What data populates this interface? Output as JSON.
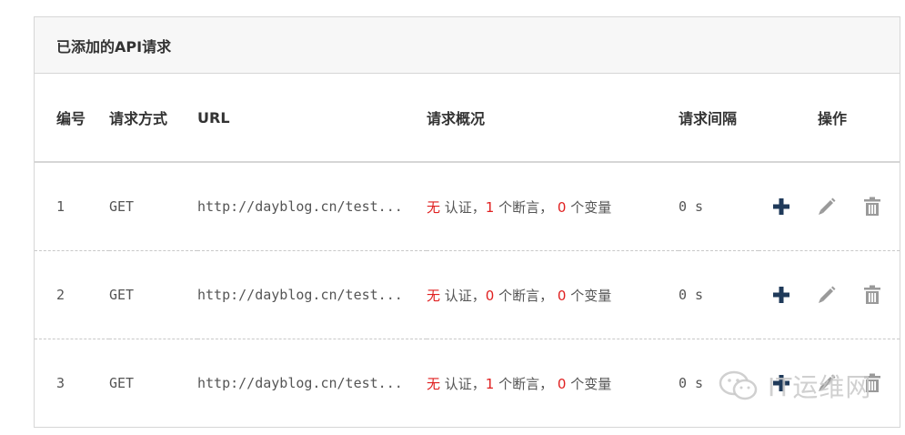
{
  "panel": {
    "title": "已添加的API请求"
  },
  "headers": {
    "id": "编号",
    "method": "请求方式",
    "url": "URL",
    "summary": "请求概况",
    "interval": "请求间隔",
    "actions": "操作"
  },
  "rows": [
    {
      "id": "1",
      "method": "GET",
      "url": "http://dayblog.cn/test...",
      "auth": "无",
      "auth_suffix": " 认证，",
      "assertions": "1",
      "assertions_suffix": " 个断言， ",
      "vars": "0",
      "vars_suffix": " 个变量",
      "interval": "0 s"
    },
    {
      "id": "2",
      "method": "GET",
      "url": "http://dayblog.cn/test...",
      "auth": "无",
      "auth_suffix": " 认证，",
      "assertions": "0",
      "assertions_suffix": " 个断言， ",
      "vars": "0",
      "vars_suffix": " 个变量",
      "interval": "0 s"
    },
    {
      "id": "3",
      "method": "GET",
      "url": "http://dayblog.cn/test...",
      "auth": "无",
      "auth_suffix": " 认证，",
      "assertions": "1",
      "assertions_suffix": " 个断言， ",
      "vars": "0",
      "vars_suffix": " 个变量",
      "interval": "0 s"
    }
  ],
  "icons": {
    "add": "plus-icon",
    "edit": "pencil-icon",
    "delete": "trash-icon"
  },
  "colors": {
    "accent_number": "#e02020",
    "add_icon": "#1f3a5a",
    "muted_icon": "#9a9a9a"
  },
  "watermark": {
    "text": "IT运维网"
  }
}
